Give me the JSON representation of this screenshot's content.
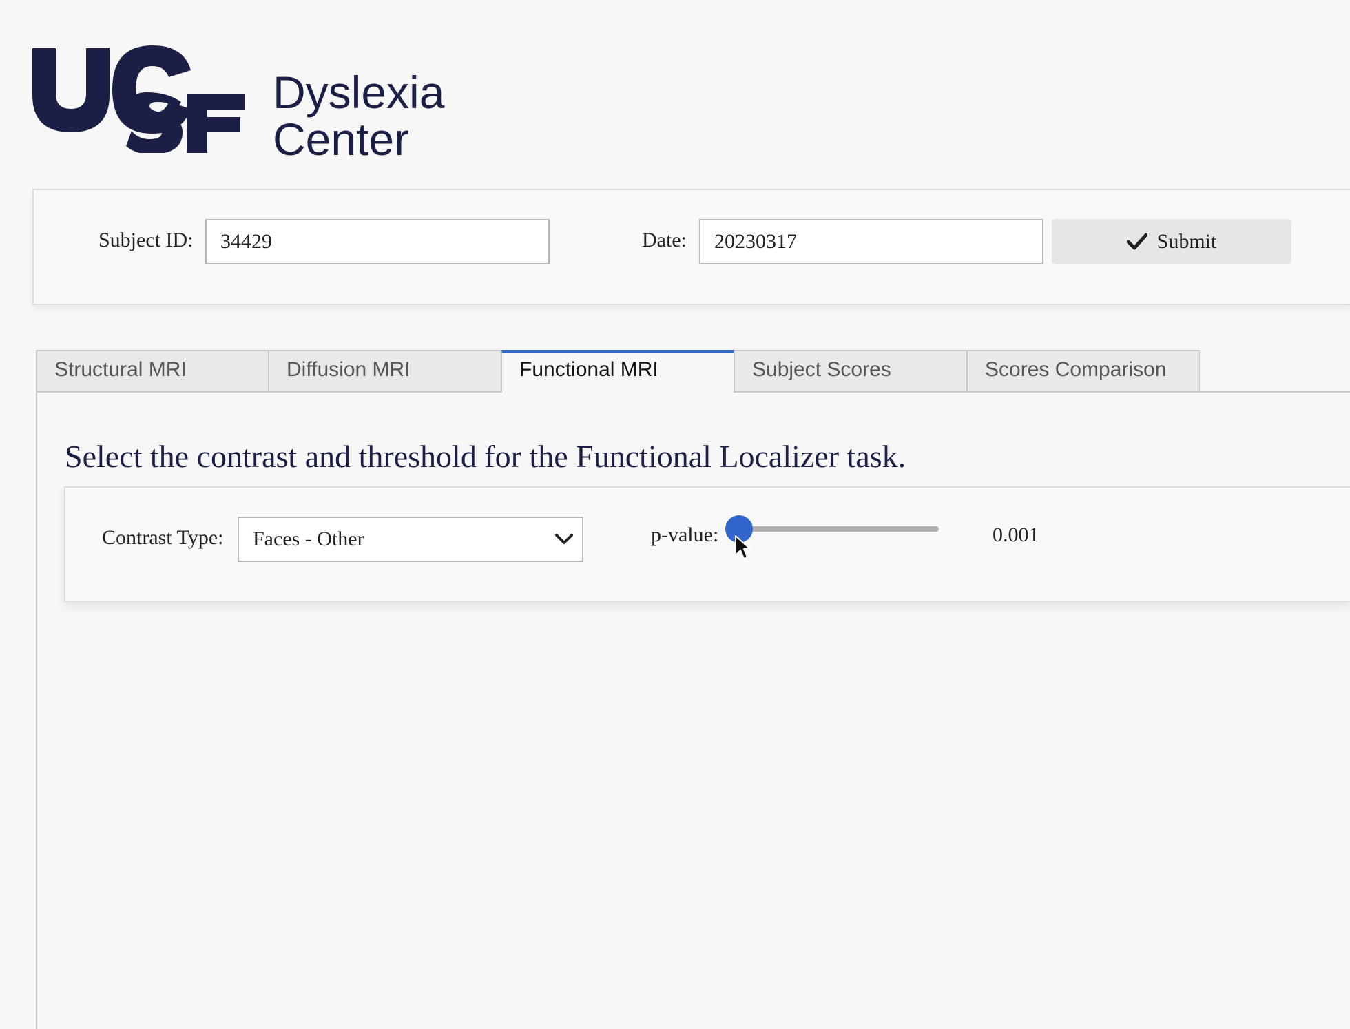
{
  "logo": {
    "wordmark": "UCSF",
    "line1": "Dyslexia",
    "line2": "Center"
  },
  "subject_form": {
    "subject_id_label": "Subject ID:",
    "subject_id_value": "34429",
    "date_label": "Date:",
    "date_value": "20230317",
    "submit_label": "Submit",
    "submit_icon": "checkmark-icon"
  },
  "tabs": [
    {
      "label": "Structural MRI",
      "active": false
    },
    {
      "label": "Diffusion MRI",
      "active": false
    },
    {
      "label": "Functional MRI",
      "active": true
    },
    {
      "label": "Subject Scores",
      "active": false
    },
    {
      "label": "Scores Comparison",
      "active": false
    }
  ],
  "functional": {
    "title": "Select the contrast and threshold for the Functional Localizer task.",
    "contrast_label": "Contrast Type:",
    "contrast_value": "Faces - Other",
    "pvalue_label": "p-value:",
    "pvalue_display": "0.001",
    "slider_fraction": 0.0
  },
  "colors": {
    "brand_navy": "#1c1f45",
    "accent_blue": "#3366cc",
    "active_tab_border": "#2f66c4"
  }
}
